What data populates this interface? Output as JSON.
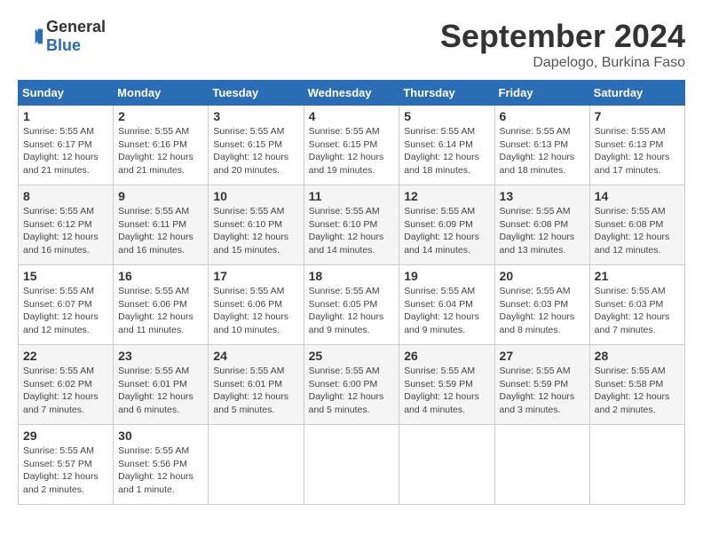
{
  "header": {
    "logo_general": "General",
    "logo_blue": "Blue",
    "month_title": "September 2024",
    "location": "Dapelogo, Burkina Faso"
  },
  "days_of_week": [
    "Sunday",
    "Monday",
    "Tuesday",
    "Wednesday",
    "Thursday",
    "Friday",
    "Saturday"
  ],
  "weeks": [
    [
      {
        "day": "1",
        "sunrise": "5:55 AM",
        "sunset": "6:17 PM",
        "daylight": "12 hours and 21 minutes."
      },
      {
        "day": "2",
        "sunrise": "5:55 AM",
        "sunset": "6:16 PM",
        "daylight": "12 hours and 21 minutes."
      },
      {
        "day": "3",
        "sunrise": "5:55 AM",
        "sunset": "6:15 PM",
        "daylight": "12 hours and 20 minutes."
      },
      {
        "day": "4",
        "sunrise": "5:55 AM",
        "sunset": "6:15 PM",
        "daylight": "12 hours and 19 minutes."
      },
      {
        "day": "5",
        "sunrise": "5:55 AM",
        "sunset": "6:14 PM",
        "daylight": "12 hours and 18 minutes."
      },
      {
        "day": "6",
        "sunrise": "5:55 AM",
        "sunset": "6:13 PM",
        "daylight": "12 hours and 18 minutes."
      },
      {
        "day": "7",
        "sunrise": "5:55 AM",
        "sunset": "6:13 PM",
        "daylight": "12 hours and 17 minutes."
      }
    ],
    [
      {
        "day": "8",
        "sunrise": "5:55 AM",
        "sunset": "6:12 PM",
        "daylight": "12 hours and 16 minutes."
      },
      {
        "day": "9",
        "sunrise": "5:55 AM",
        "sunset": "6:11 PM",
        "daylight": "12 hours and 16 minutes."
      },
      {
        "day": "10",
        "sunrise": "5:55 AM",
        "sunset": "6:10 PM",
        "daylight": "12 hours and 15 minutes."
      },
      {
        "day": "11",
        "sunrise": "5:55 AM",
        "sunset": "6:10 PM",
        "daylight": "12 hours and 14 minutes."
      },
      {
        "day": "12",
        "sunrise": "5:55 AM",
        "sunset": "6:09 PM",
        "daylight": "12 hours and 14 minutes."
      },
      {
        "day": "13",
        "sunrise": "5:55 AM",
        "sunset": "6:08 PM",
        "daylight": "12 hours and 13 minutes."
      },
      {
        "day": "14",
        "sunrise": "5:55 AM",
        "sunset": "6:08 PM",
        "daylight": "12 hours and 12 minutes."
      }
    ],
    [
      {
        "day": "15",
        "sunrise": "5:55 AM",
        "sunset": "6:07 PM",
        "daylight": "12 hours and 12 minutes."
      },
      {
        "day": "16",
        "sunrise": "5:55 AM",
        "sunset": "6:06 PM",
        "daylight": "12 hours and 11 minutes."
      },
      {
        "day": "17",
        "sunrise": "5:55 AM",
        "sunset": "6:06 PM",
        "daylight": "12 hours and 10 minutes."
      },
      {
        "day": "18",
        "sunrise": "5:55 AM",
        "sunset": "6:05 PM",
        "daylight": "12 hours and 9 minutes."
      },
      {
        "day": "19",
        "sunrise": "5:55 AM",
        "sunset": "6:04 PM",
        "daylight": "12 hours and 9 minutes."
      },
      {
        "day": "20",
        "sunrise": "5:55 AM",
        "sunset": "6:03 PM",
        "daylight": "12 hours and 8 minutes."
      },
      {
        "day": "21",
        "sunrise": "5:55 AM",
        "sunset": "6:03 PM",
        "daylight": "12 hours and 7 minutes."
      }
    ],
    [
      {
        "day": "22",
        "sunrise": "5:55 AM",
        "sunset": "6:02 PM",
        "daylight": "12 hours and 7 minutes."
      },
      {
        "day": "23",
        "sunrise": "5:55 AM",
        "sunset": "6:01 PM",
        "daylight": "12 hours and 6 minutes."
      },
      {
        "day": "24",
        "sunrise": "5:55 AM",
        "sunset": "6:01 PM",
        "daylight": "12 hours and 5 minutes."
      },
      {
        "day": "25",
        "sunrise": "5:55 AM",
        "sunset": "6:00 PM",
        "daylight": "12 hours and 5 minutes."
      },
      {
        "day": "26",
        "sunrise": "5:55 AM",
        "sunset": "5:59 PM",
        "daylight": "12 hours and 4 minutes."
      },
      {
        "day": "27",
        "sunrise": "5:55 AM",
        "sunset": "5:59 PM",
        "daylight": "12 hours and 3 minutes."
      },
      {
        "day": "28",
        "sunrise": "5:55 AM",
        "sunset": "5:58 PM",
        "daylight": "12 hours and 2 minutes."
      }
    ],
    [
      {
        "day": "29",
        "sunrise": "5:55 AM",
        "sunset": "5:57 PM",
        "daylight": "12 hours and 2 minutes."
      },
      {
        "day": "30",
        "sunrise": "5:55 AM",
        "sunset": "5:56 PM",
        "daylight": "12 hours and 1 minute."
      },
      null,
      null,
      null,
      null,
      null
    ]
  ]
}
